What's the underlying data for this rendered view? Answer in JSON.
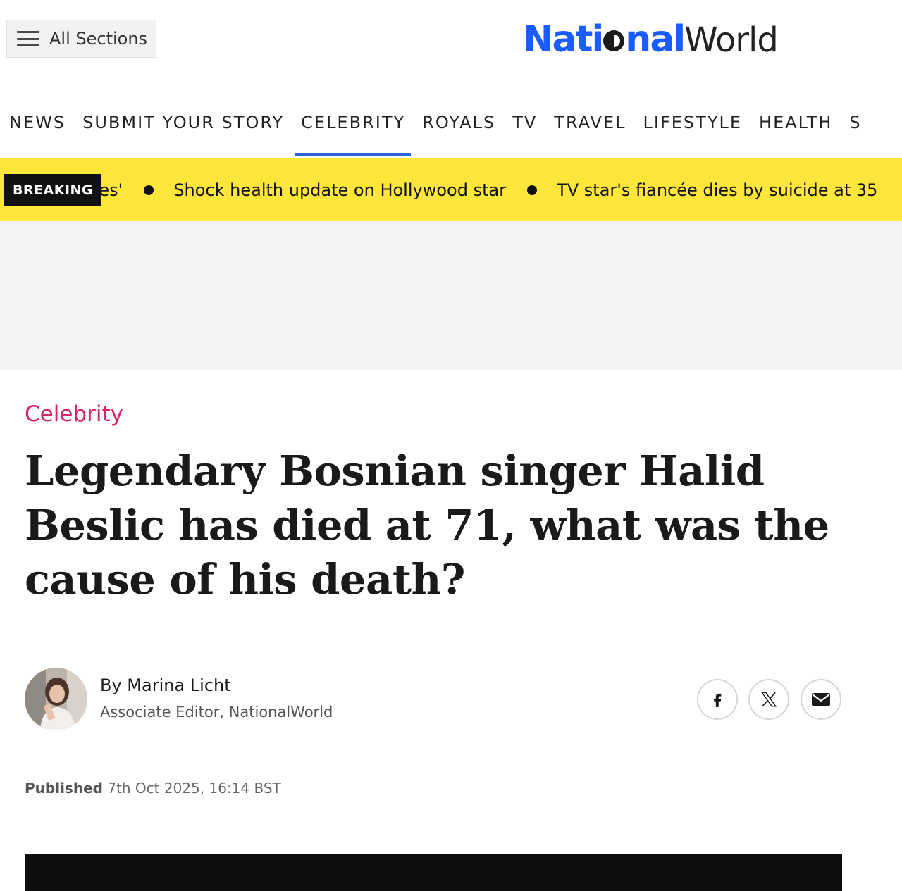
{
  "header": {
    "sections_label": "All Sections",
    "logo_national_pre": "Nati",
    "logo_national_post": "nal",
    "logo_world": "World"
  },
  "nav": {
    "items": [
      "NEWS",
      "SUBMIT YOUR STORY",
      "CELEBRITY",
      "ROYALS",
      "TV",
      "TRAVEL",
      "LIFESTYLE",
      "HEALTH",
      "S"
    ],
    "active": "CELEBRITY"
  },
  "breaking": {
    "badge": "BREAKING",
    "items": [
      "nces'",
      "Shock health update on Hollywood star",
      "TV star's fiancée dies by suicide at 35"
    ]
  },
  "article": {
    "category": "Celebrity",
    "headline": "Legendary Bosnian singer Halid Beslic has died at 71, what was the cause of his death?",
    "author_name": "By Marina Licht",
    "author_role": "Associate Editor, NationalWorld",
    "published_label": "Published",
    "published_date": "7th Oct 2025, 16:14 BST"
  },
  "colors": {
    "brand_blue": "#1a5cff",
    "breaking_yellow": "#ffe63b",
    "category_pink": "#d6246e",
    "active_underline": "#2b63d9"
  },
  "icons": {
    "menu": "hamburger-icon",
    "facebook": "facebook-icon",
    "x": "x-icon",
    "mail": "mail-icon"
  }
}
